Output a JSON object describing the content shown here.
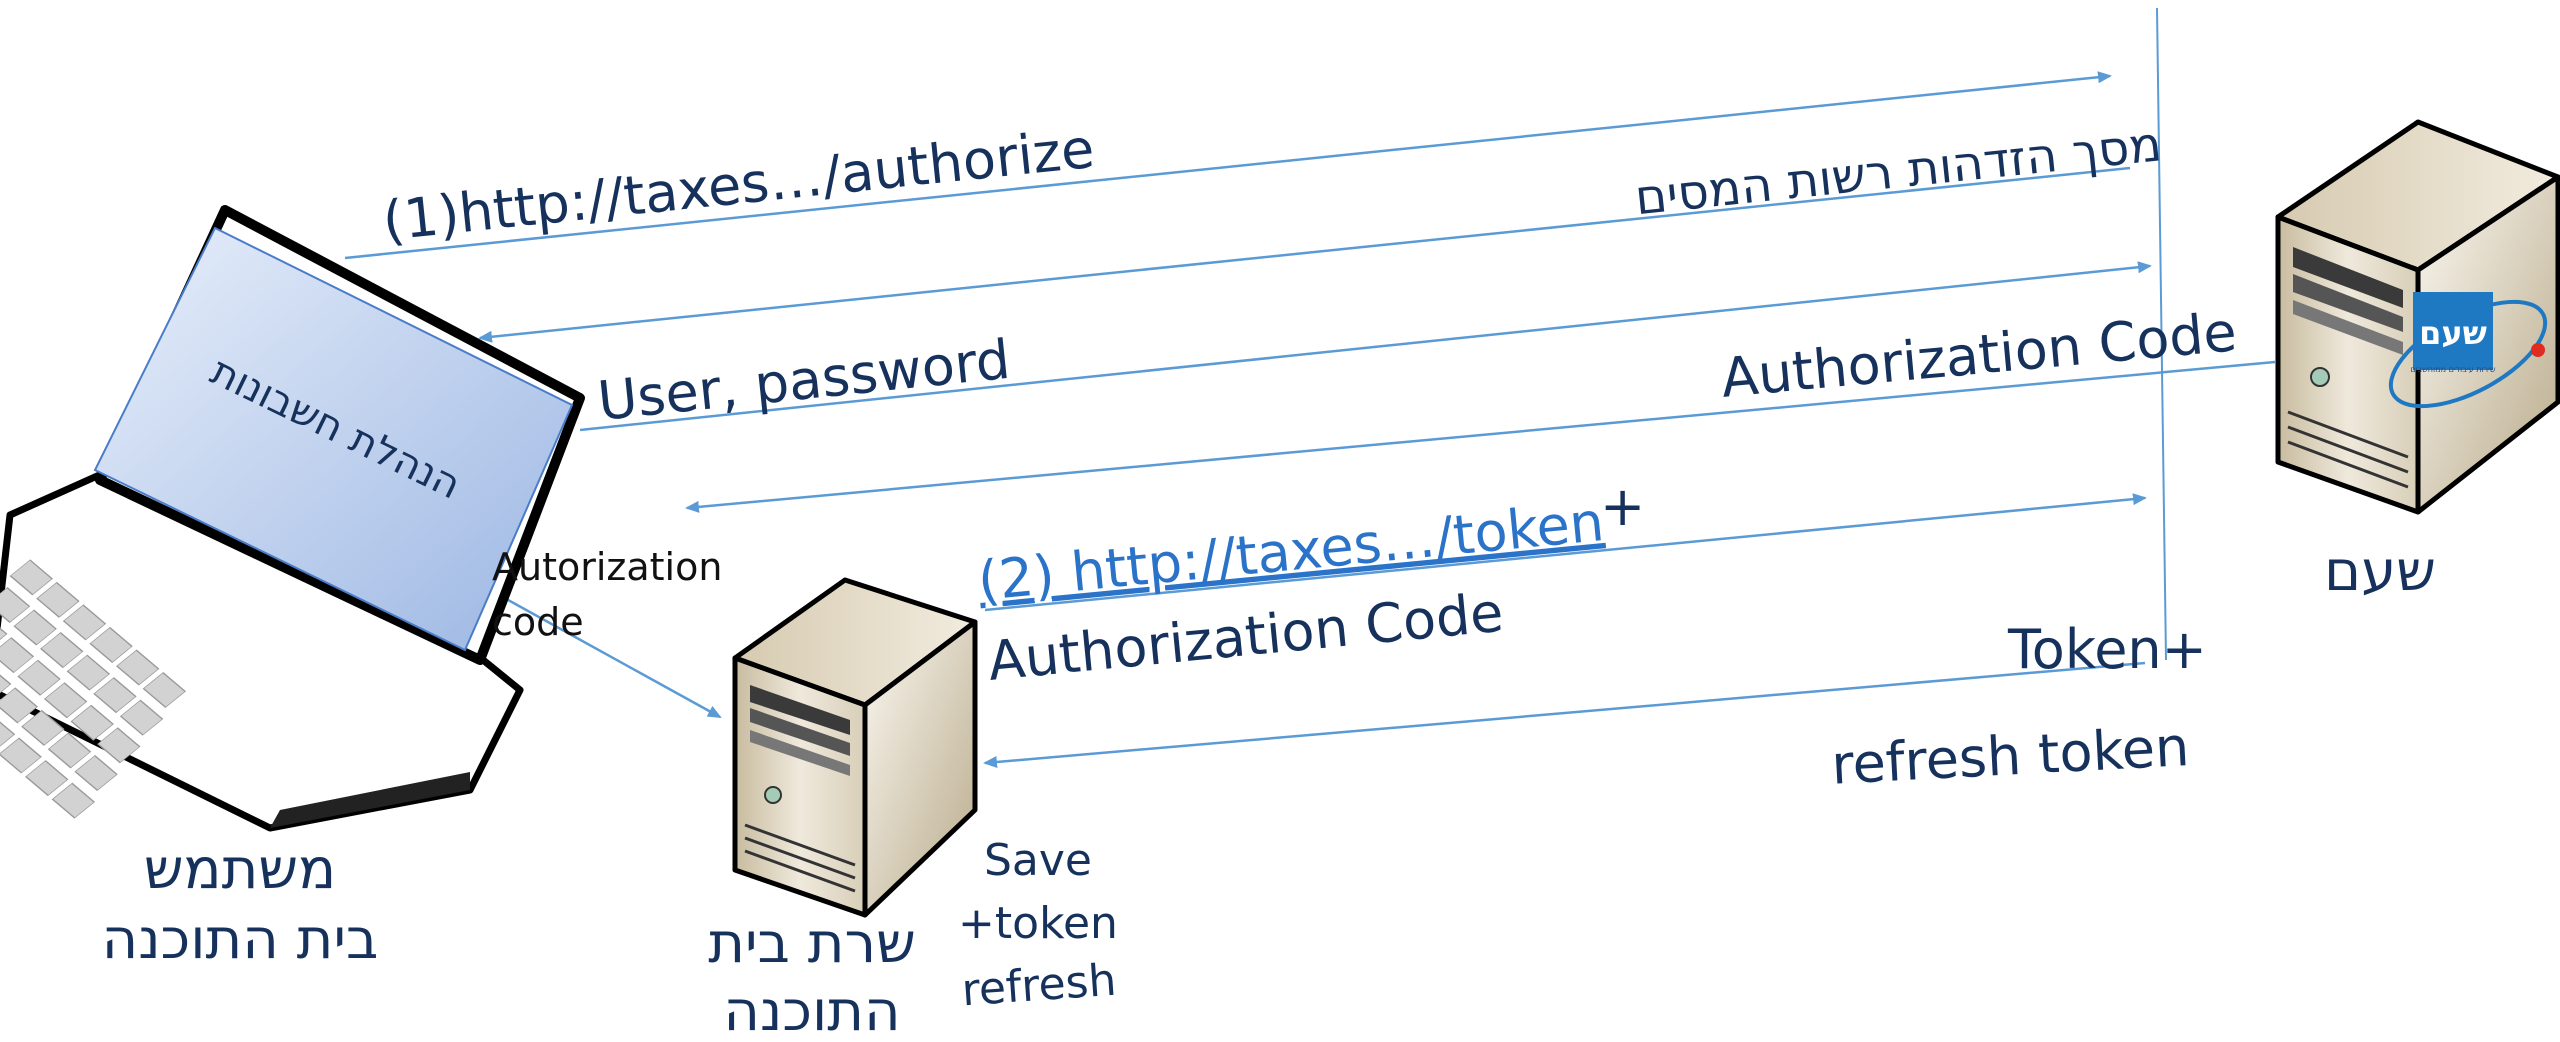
{
  "labels": {
    "step1_url": "(1)http://taxes…/authorize",
    "tax_login_screen": "מסך הזדהות רשות המסים",
    "user_password": "User, password",
    "authorization_code": "Authorization Code",
    "screen_text": "הנהלת חשבונות",
    "autorization_code_line1": "Autorization",
    "autorization_code_line2": "code",
    "step2_url": "(2) http://taxes…/token",
    "plus": "+",
    "step2_auth_code": "Authorization Code",
    "token_plus": "Token+",
    "refresh_token": "refresh token",
    "shaam": "שעם",
    "user_line1": "משתמש",
    "user_line2": "בית התוכנה",
    "server_line1": "שרת בית",
    "server_line2": "התוכנה",
    "save_line1": "Save",
    "save_line2": "+token",
    "save_line3": "refresh"
  },
  "logo": {
    "brand": "שעם",
    "tagline": "שירות עיבודים ממוחשבים",
    "color": "#1e78c2"
  },
  "colors": {
    "arrow": "#5b9bd5",
    "text": "#16325c",
    "link": "#2a73c9"
  },
  "icons": [
    "laptop-icon",
    "server-icon",
    "server-icon"
  ]
}
